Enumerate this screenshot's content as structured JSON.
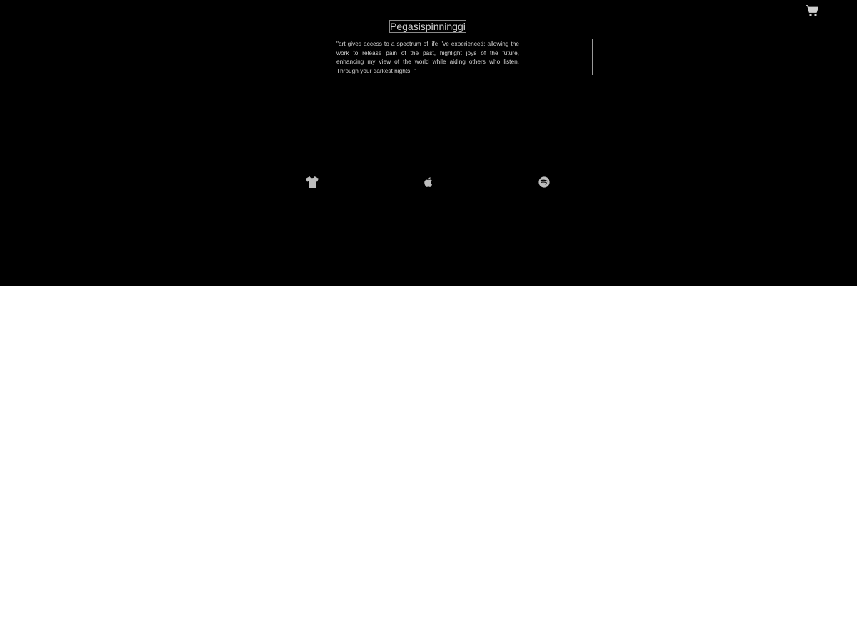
{
  "header": {
    "cart_icon": "shopping-cart-icon",
    "logo_alt": "Pegasispinninggif"
  },
  "main": {
    "quote": "\"art gives access to a spectrum of life I've experienced; allowing the work to release pain of the past, highlight joys of the future, enhancing my view of the world while aiding others who listen. Through your darkest nights. \""
  },
  "links": [
    {
      "icon": "tshirt-icon"
    },
    {
      "icon": "apple-icon"
    },
    {
      "icon": "spotify-icon"
    }
  ],
  "colors": {
    "background": "#000000",
    "icon": "#bdbdbd",
    "text": "#d2d2d2",
    "page": "#ffffff"
  }
}
